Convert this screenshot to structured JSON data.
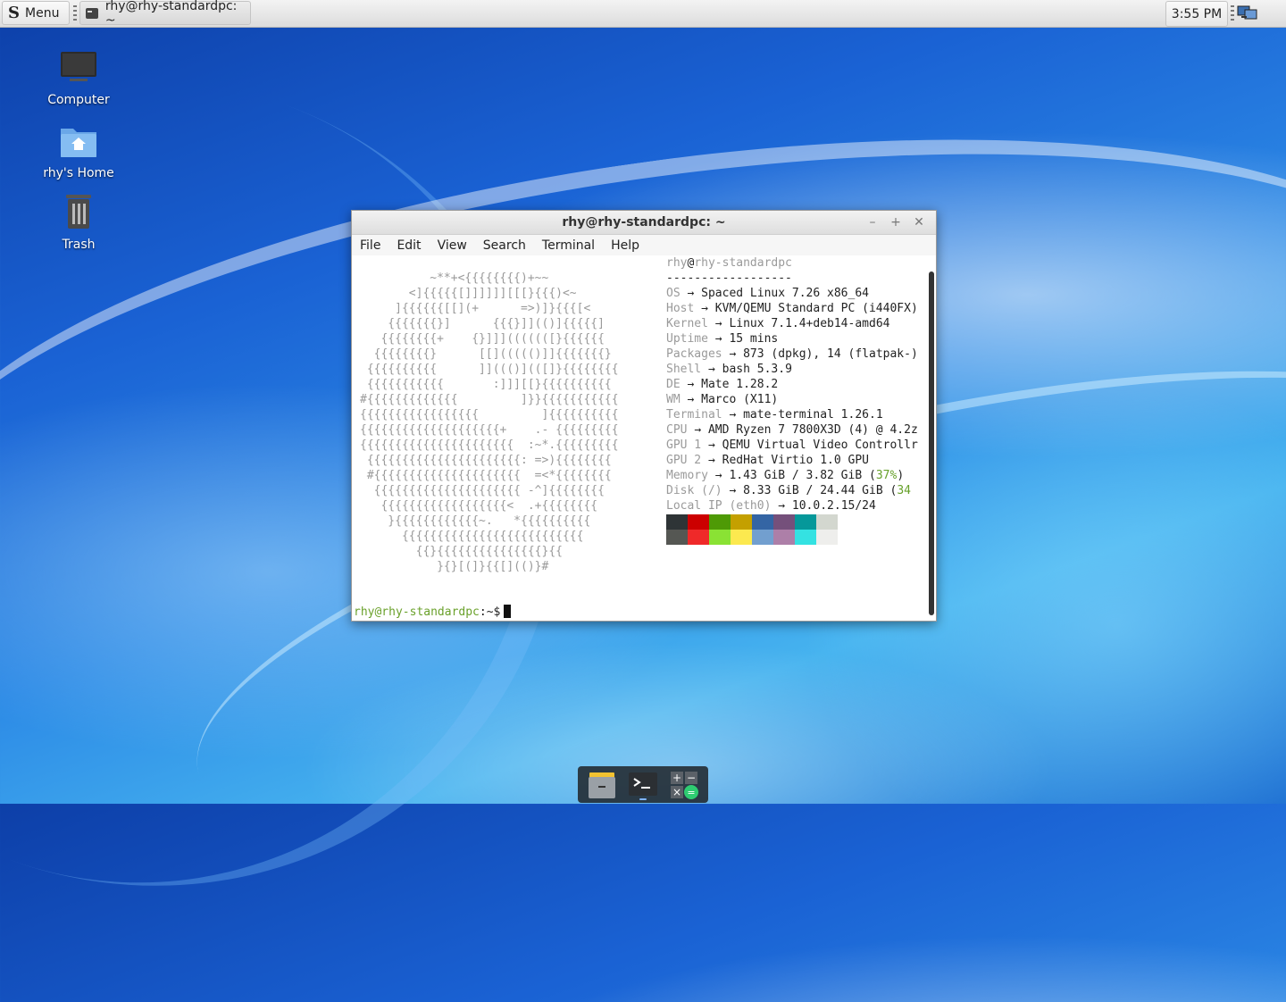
{
  "panel": {
    "menu_label": "Menu",
    "task_title": "rhy@rhy-standardpc: ~",
    "clock": "3:55 PM"
  },
  "desktop": {
    "icons": [
      {
        "label": "Computer",
        "icon": "computer-icon"
      },
      {
        "label": "rhy's Home",
        "icon": "home-folder-icon"
      },
      {
        "label": "Trash",
        "icon": "trash-icon"
      }
    ]
  },
  "window": {
    "title": "rhy@rhy-standardpc: ~",
    "menu": [
      "File",
      "Edit",
      "View",
      "Search",
      "Terminal",
      "Help"
    ]
  },
  "terminal": {
    "ascii_art": "          ~**+<{{{{{{{{)+~~\n       <]{{{{{[]]]]]][[[}{{{)<~\n     ]{{{{{{[[](+      =>)]}{{{[<\n    {{{{{{{}]      {{{}]](()]{{{{{]\n   {{{{{{{{+    {}]]](((((([}{{{{{{\n  {{{{{{{{}      [[]((((()]]{{{{{{{}\n {{{{{{{{{{      ]]((()](([]}{{{{{{{{\n {{{{{{{{{{{       :]]][[}{{{{{{{{{{\n#{{{{{{{{{{{{{         ]}}{{{{{{{{{{{\n{{{{{{{{{{{{{{{{{         ]{{{{{{{{{{\n{{{{{{{{{{{{{{{{{{{{+    .- {{{{{{{{{\n{{{{{{{{{{{{{{{{{{{{{{  :~*.{{{{{{{{{\n {{{{{{{{{{{{{{{{{{{{{{: =>){{{{{{{{\n #{{{{{{{{{{{{{{{{{{{{{  =<*{{{{{{{{\n  {{{{{{{{{{{{{{{{{{{{{ -^]{{{{{{{{\n   {{{{{{{{{{{{{{{{{{<  .+{{{{{{{{\n    }{{{{{{{{{{{{~.   *{{{{{{{{{{\n      {{{{{{{{{{{{{{{{{{{{{{{{{{\n        {{}{{{{{{{{{{{{{{{}{{\n           }{}[(]}{{[](()}#",
    "header_user": "rhy",
    "header_at": "@",
    "header_host": "rhy-standardpc",
    "separator": "------------------",
    "arrow": "→",
    "info": [
      {
        "key": "OS",
        "value": "Spaced Linux 7.26 x86_64"
      },
      {
        "key": "Host",
        "value": "KVM/QEMU Standard PC (i440FX)"
      },
      {
        "key": "Kernel",
        "value": "Linux 7.1.4+deb14-amd64"
      },
      {
        "key": "Uptime",
        "value": "15 mins"
      },
      {
        "key": "Packages",
        "value": "873 (dpkg), 14 (flatpak-)"
      },
      {
        "key": "Shell",
        "value": "bash 5.3.9"
      },
      {
        "key": "DE",
        "value": "Mate 1.28.2"
      },
      {
        "key": "WM",
        "value": "Marco (X11)"
      },
      {
        "key": "Terminal",
        "value": "mate-terminal 1.26.1"
      },
      {
        "key": "CPU",
        "value": "AMD Ryzen 7 7800X3D (4) @ 4.2z"
      },
      {
        "key": "GPU 1",
        "value": "QEMU Virtual Video Controllr"
      },
      {
        "key": "GPU 2",
        "value": "RedHat Virtio 1.0 GPU"
      }
    ],
    "memory": {
      "key": "Memory",
      "value": "1.43 GiB / 3.82 GiB",
      "open": "(",
      "pct": "37%",
      "close": ")"
    },
    "disk": {
      "key": "Disk",
      "mount": "(/)",
      "value": "8.33 GiB / 24.44 GiB",
      "open": "(",
      "pct": "34"
    },
    "local_ip": {
      "key": "Local IP",
      "iface": "(eth0)",
      "value": "10.0.2.15/24"
    },
    "palette": [
      "#2e3436",
      "#cc0000",
      "#4e9a06",
      "#c4a000",
      "#3465a4",
      "#75507b",
      "#06989a",
      "#d3d7cf",
      "#555753",
      "#ef2929",
      "#8ae234",
      "#fce94f",
      "#729fcf",
      "#ad7fa8",
      "#34e2e2",
      "#eeeeec"
    ],
    "prompt_user": "rhy@rhy-standardpc",
    "prompt_path": ":~$"
  },
  "dock": [
    {
      "icon": "file-manager-icon"
    },
    {
      "icon": "terminal-icon"
    },
    {
      "icon": "calculator-icon"
    }
  ]
}
